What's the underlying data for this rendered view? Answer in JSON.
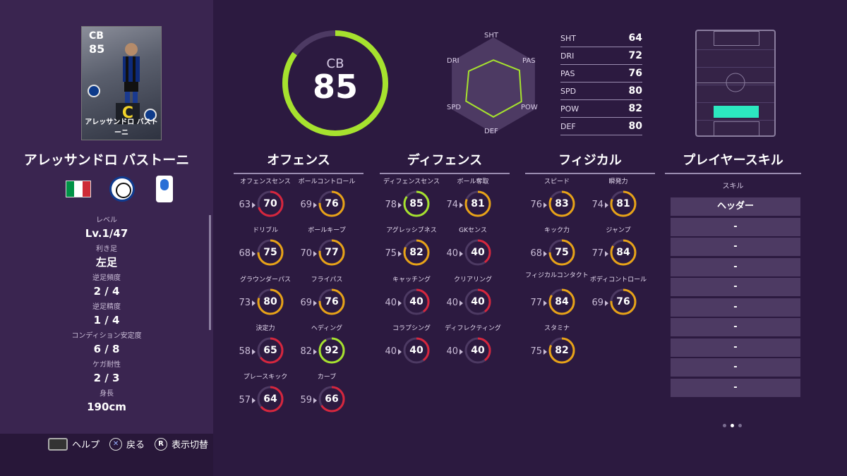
{
  "player": {
    "card_position": "CB",
    "card_rating": "85",
    "card_name": "アレッサンドロ バストーニ",
    "card_badge": "C",
    "name": "アレッサンドロ バストーニ",
    "nationality_flag_colors": [
      "#009246",
      "#ffffff",
      "#ce2b37"
    ]
  },
  "info": [
    {
      "label": "レベル",
      "value": "Lv.1/47"
    },
    {
      "label": "利き足",
      "value": "左足"
    },
    {
      "label": "逆足頻度",
      "value": "2 / 4"
    },
    {
      "label": "逆足精度",
      "value": "1 / 4"
    },
    {
      "label": "コンディション安定度",
      "value": "6 / 8"
    },
    {
      "label": "ケガ耐性",
      "value": "2 / 3"
    },
    {
      "label": "身長",
      "value": "190cm"
    }
  ],
  "overall": {
    "position": "CB",
    "rating": "85",
    "ring_fraction": 0.85,
    "ring_color": "#a6e22e"
  },
  "radar": {
    "labels": [
      "SHT",
      "PAS",
      "POW",
      "DEF",
      "SPD",
      "DRI"
    ],
    "values": [
      64,
      76,
      82,
      80,
      80,
      72
    ]
  },
  "summary_stats": [
    {
      "label": "SHT",
      "value": "64"
    },
    {
      "label": "DRI",
      "value": "72"
    },
    {
      "label": "PAS",
      "value": "76"
    },
    {
      "label": "SPD",
      "value": "80"
    },
    {
      "label": "POW",
      "value": "82"
    },
    {
      "label": "DEF",
      "value": "80"
    }
  ],
  "categories": {
    "offense": {
      "title": "オフェンス",
      "items": [
        {
          "name": "オフェンスセンス",
          "base": "63",
          "value": "70",
          "color": "#d7263d"
        },
        {
          "name": "ボールコントロール",
          "base": "69",
          "value": "76",
          "color": "#e8a317"
        },
        {
          "name": "ドリブル",
          "base": "68",
          "value": "75",
          "color": "#e8a317"
        },
        {
          "name": "ボールキープ",
          "base": "70",
          "value": "77",
          "color": "#e8a317"
        },
        {
          "name": "グラウンダーパス",
          "base": "73",
          "value": "80",
          "color": "#e8a317"
        },
        {
          "name": "フライパス",
          "base": "69",
          "value": "76",
          "color": "#e8a317"
        },
        {
          "name": "決定力",
          "base": "58",
          "value": "65",
          "color": "#d7263d"
        },
        {
          "name": "ヘディング",
          "base": "82",
          "value": "92",
          "color": "#a6e22e"
        },
        {
          "name": "プレースキック",
          "base": "57",
          "value": "64",
          "color": "#d7263d"
        },
        {
          "name": "カーブ",
          "base": "59",
          "value": "66",
          "color": "#d7263d"
        }
      ]
    },
    "defense": {
      "title": "ディフェンス",
      "items": [
        {
          "name": "ディフェンスセンス",
          "base": "78",
          "value": "85",
          "color": "#a6e22e"
        },
        {
          "name": "ボール奪取",
          "base": "74",
          "value": "81",
          "color": "#e8a317"
        },
        {
          "name": "アグレッシブネス",
          "base": "75",
          "value": "82",
          "color": "#e8a317"
        },
        {
          "name": "GKセンス",
          "base": "40",
          "value": "40",
          "color": "#d7263d"
        },
        {
          "name": "キャッチング",
          "base": "40",
          "value": "40",
          "color": "#d7263d"
        },
        {
          "name": "クリアリング",
          "base": "40",
          "value": "40",
          "color": "#d7263d"
        },
        {
          "name": "コラプシング",
          "base": "40",
          "value": "40",
          "color": "#d7263d"
        },
        {
          "name": "ディフレクティング",
          "base": "40",
          "value": "40",
          "color": "#d7263d"
        }
      ]
    },
    "physical": {
      "title": "フィジカル",
      "items": [
        {
          "name": "スピード",
          "base": "76",
          "value": "83",
          "color": "#e8a317"
        },
        {
          "name": "瞬発力",
          "base": "74",
          "value": "81",
          "color": "#e8a317"
        },
        {
          "name": "キック力",
          "base": "68",
          "value": "75",
          "color": "#e8a317"
        },
        {
          "name": "ジャンプ",
          "base": "77",
          "value": "84",
          "color": "#e8a317"
        },
        {
          "name": "フィジカルコンタクト",
          "base": "77",
          "value": "84",
          "color": "#e8a317"
        },
        {
          "name": "ボディコントロール",
          "base": "69",
          "value": "76",
          "color": "#e8a317"
        },
        {
          "name": "スタミナ",
          "base": "75",
          "value": "82",
          "color": "#e8a317"
        }
      ]
    }
  },
  "skills": {
    "title": "プレイヤースキル",
    "subtitle": "スキル",
    "items": [
      "ヘッダー",
      "-",
      "-",
      "-",
      "-",
      "-",
      "-",
      "-",
      "-",
      "-"
    ]
  },
  "footer": {
    "help": "ヘルプ",
    "back": "戻る",
    "toggle": "表示切替",
    "r_button": "R"
  }
}
